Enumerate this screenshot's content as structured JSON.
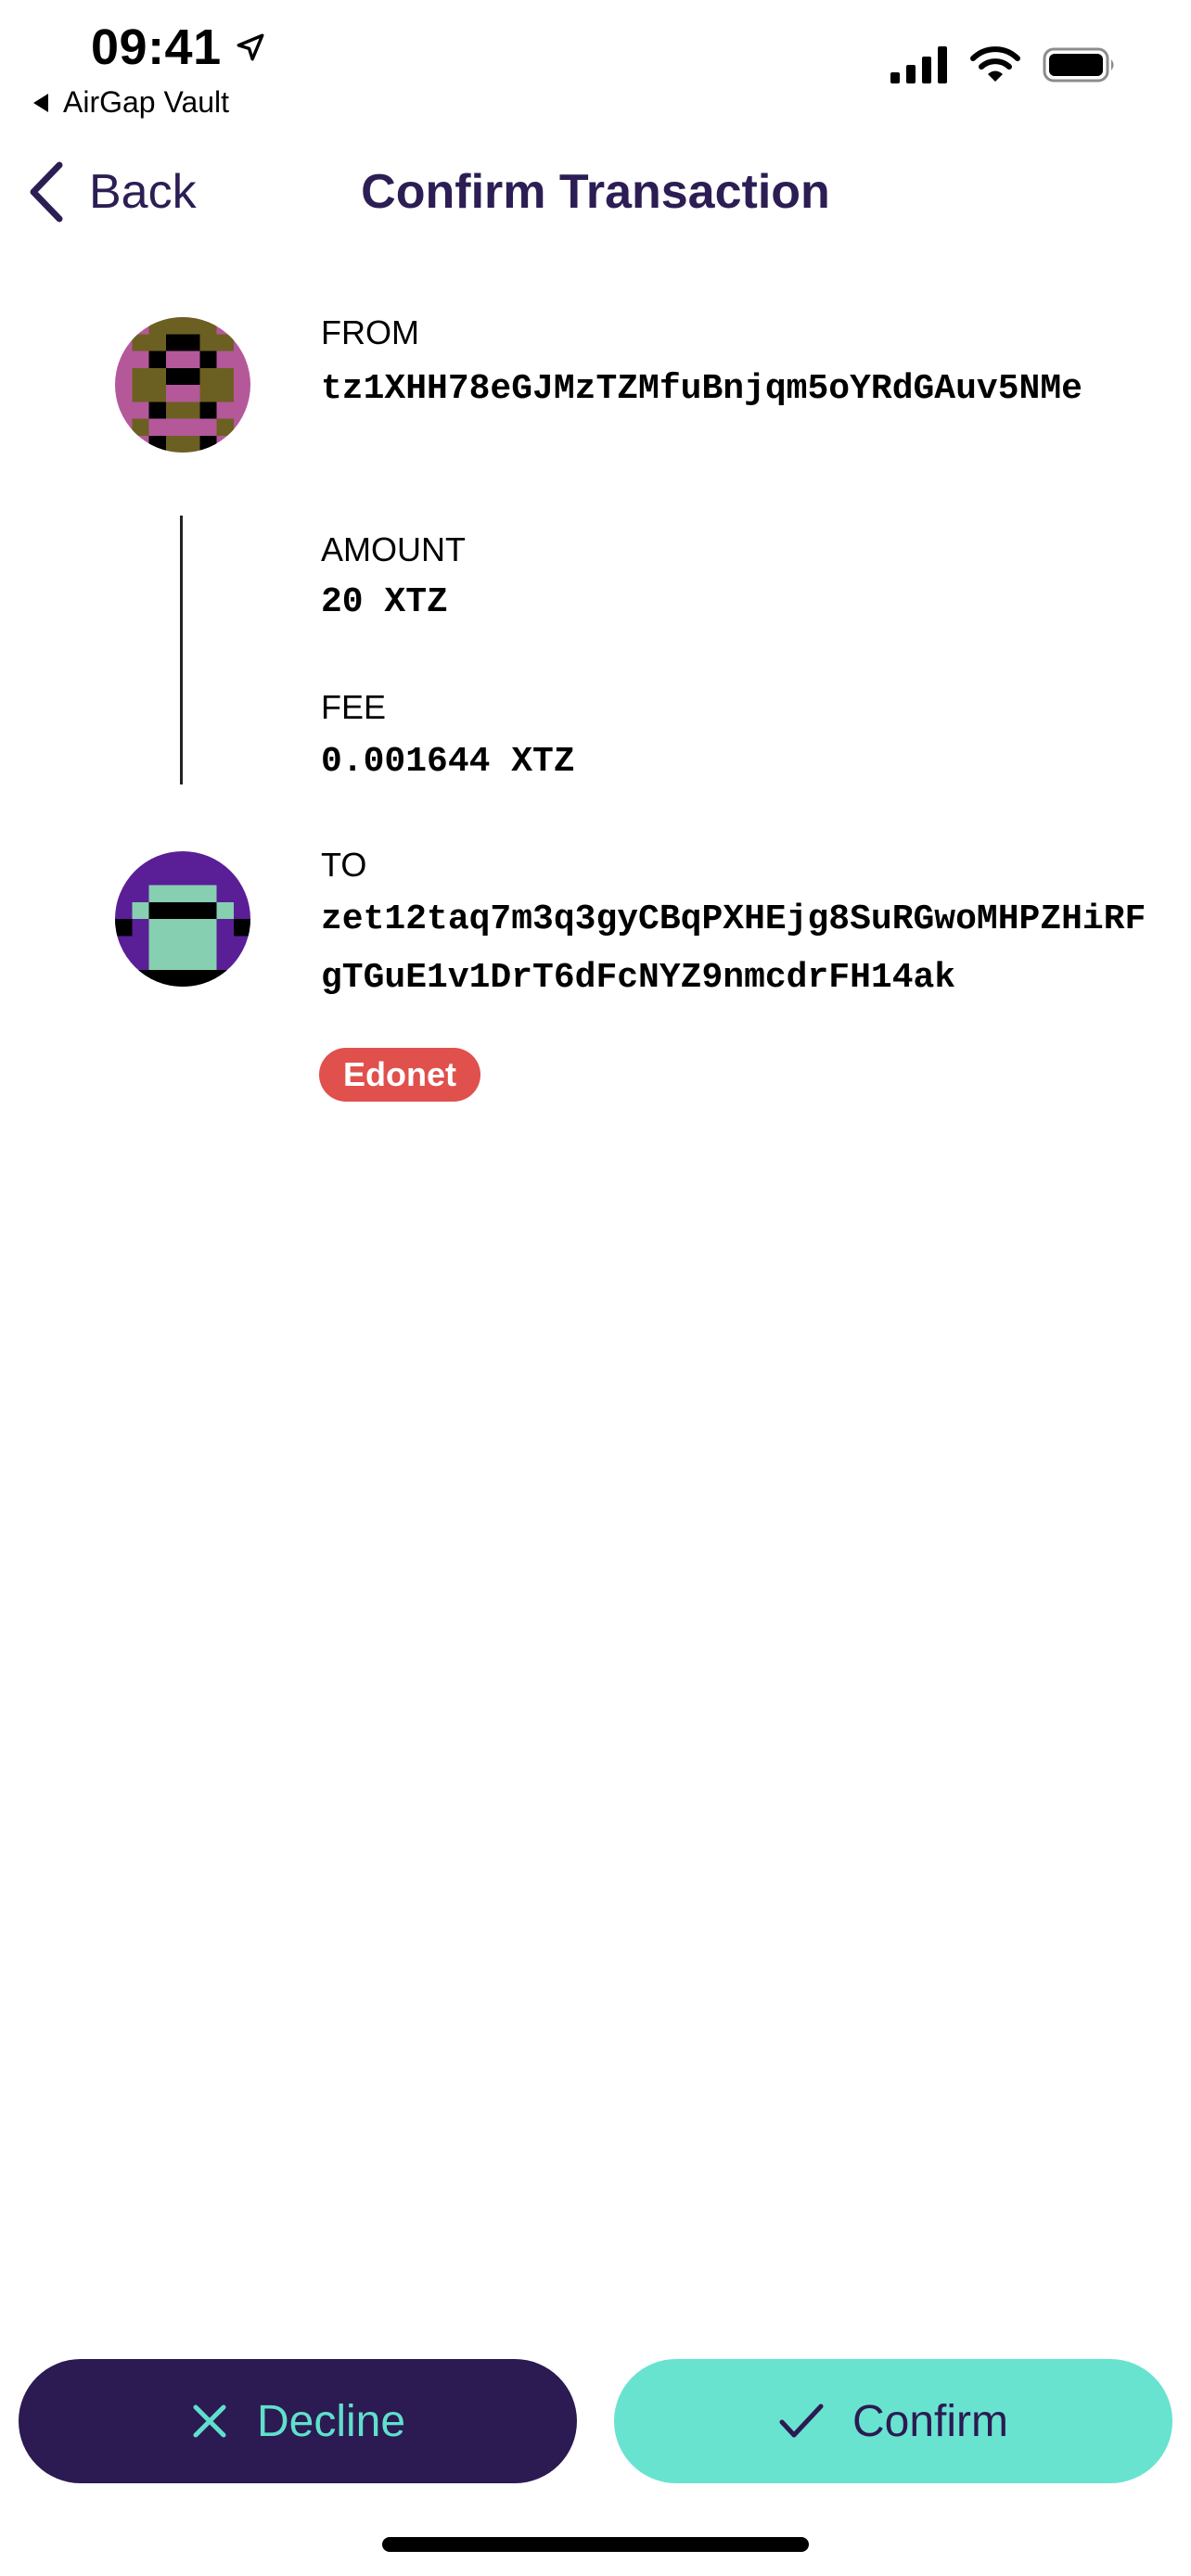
{
  "status_bar": {
    "time": "09:41",
    "back_app": "AirGap Vault",
    "icons": [
      "location-arrow-icon",
      "cellular-signal-icon",
      "wifi-icon",
      "battery-icon"
    ]
  },
  "nav": {
    "back_label": "Back",
    "title": "Confirm Transaction"
  },
  "transaction": {
    "from": {
      "label": "FROM",
      "address": "tz1XHH78eGJMzTZMfuBnjqm5oYRdGAuv5NMe"
    },
    "amount": {
      "label": "AMOUNT",
      "value": "20 XTZ"
    },
    "fee": {
      "label": "FEE",
      "value": "0.001644 XTZ"
    },
    "to": {
      "label": "TO",
      "address": "zet12taq7m3q3gyCBqPXHEjg8SuRGwoMHPZHiRFgTGuE1v1DrT6dFcNYZ9nmcdrFH14ak"
    },
    "network": "Edonet"
  },
  "actions": {
    "decline_label": "Decline",
    "confirm_label": "Confirm"
  },
  "colors": {
    "primary": "#2c1e54",
    "accent": "#68e3cf",
    "badge": "#e0504c",
    "from_identicon": [
      "#b4589a",
      "#6b6022",
      "#000000"
    ],
    "to_identicon": [
      "#5a1f96",
      "#86cfb0",
      "#000000"
    ]
  }
}
